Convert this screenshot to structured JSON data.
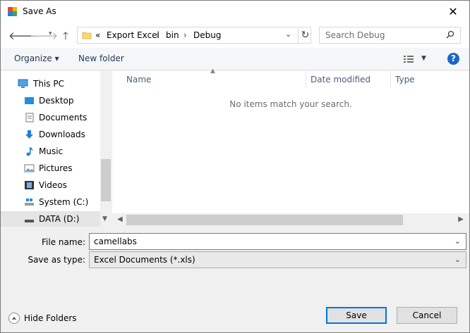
{
  "window": {
    "title": "Save As",
    "close_glyph": "✕"
  },
  "address": {
    "overflow": "«",
    "crumbs": [
      "Export Excel",
      "bin",
      "Debug"
    ],
    "separator": "›"
  },
  "search": {
    "placeholder": "Search Debug"
  },
  "toolbar": {
    "organize": "Organize ▾",
    "new_folder": "New folder"
  },
  "nav": {
    "items": [
      {
        "label": "This PC",
        "icon": "pc-icon"
      },
      {
        "label": "Desktop",
        "icon": "desktop-icon"
      },
      {
        "label": "Documents",
        "icon": "documents-icon"
      },
      {
        "label": "Downloads",
        "icon": "downloads-icon"
      },
      {
        "label": "Music",
        "icon": "music-icon"
      },
      {
        "label": "Pictures",
        "icon": "pictures-icon"
      },
      {
        "label": "Videos",
        "icon": "videos-icon"
      },
      {
        "label": "System (C:)",
        "icon": "drive-c-icon"
      },
      {
        "label": "DATA (D:)",
        "icon": "drive-d-icon"
      }
    ]
  },
  "list": {
    "columns": [
      "Name",
      "Date modified",
      "Type"
    ],
    "empty_message": "No items match your search."
  },
  "form": {
    "file_name_label": "File name:",
    "file_name_value": "camellabs",
    "save_type_label": "Save as type:",
    "save_type_value": "Excel Documents (*.xls)"
  },
  "footer": {
    "hide_folders": "Hide Folders",
    "save": "Save",
    "cancel": "Cancel"
  },
  "colors": {
    "accent": "#0078d7",
    "selected": "#cce8ff",
    "help": "#1a67c7"
  }
}
